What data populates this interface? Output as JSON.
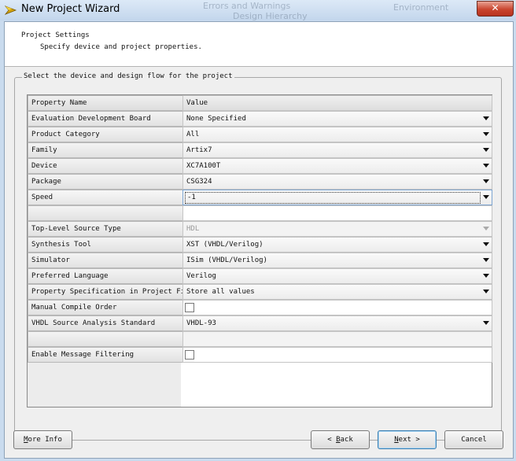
{
  "window": {
    "title": "New Project Wizard",
    "close_glyph": "✕",
    "background_hints": [
      "Errors and Warnings",
      "Design Hierarchy",
      "Environment"
    ]
  },
  "header": {
    "title": "Project Settings",
    "subtitle": "Specify device and project properties."
  },
  "group": {
    "label": "Select the device and design flow for the project"
  },
  "grid": {
    "columns": [
      "Property Name",
      "Value"
    ],
    "rows": [
      {
        "name": "Evaluation Development Board",
        "value": "None Specified",
        "kind": "combo"
      },
      {
        "name": "Product Category",
        "value": "All",
        "kind": "combo"
      },
      {
        "name": "Family",
        "value": "Artix7",
        "kind": "combo"
      },
      {
        "name": "Device",
        "value": "XC7A100T",
        "kind": "combo"
      },
      {
        "name": "Package",
        "value": "CSG324",
        "kind": "combo"
      },
      {
        "name": "Speed",
        "value": "-1",
        "kind": "combo-selected"
      },
      {
        "name": "",
        "value": "",
        "kind": "empty"
      },
      {
        "name": "Top-Level Source Type",
        "value": "HDL",
        "kind": "combo-disabled"
      },
      {
        "name": "Synthesis Tool",
        "value": "XST (VHDL/Verilog)",
        "kind": "combo"
      },
      {
        "name": "Simulator",
        "value": "ISim (VHDL/Verilog)",
        "kind": "combo"
      },
      {
        "name": "Preferred Language",
        "value": "Verilog",
        "kind": "combo"
      },
      {
        "name": "Property Specification in Project File",
        "value": "Store all values",
        "kind": "combo"
      },
      {
        "name": "Manual Compile Order",
        "value": "",
        "kind": "checkbox"
      },
      {
        "name": "VHDL Source Analysis Standard",
        "value": "VHDL-93",
        "kind": "combo"
      },
      {
        "name": "",
        "value": "",
        "kind": "empty-disabled"
      },
      {
        "name": "Enable Message Filtering",
        "value": "",
        "kind": "checkbox"
      }
    ]
  },
  "buttons": {
    "more_info": {
      "mnemonic": "M",
      "rest": "ore Info"
    },
    "back": {
      "prefix": "< ",
      "mnemonic": "B",
      "rest": "ack"
    },
    "next": {
      "mnemonic": "N",
      "rest": "ext >"
    },
    "cancel": "Cancel"
  }
}
